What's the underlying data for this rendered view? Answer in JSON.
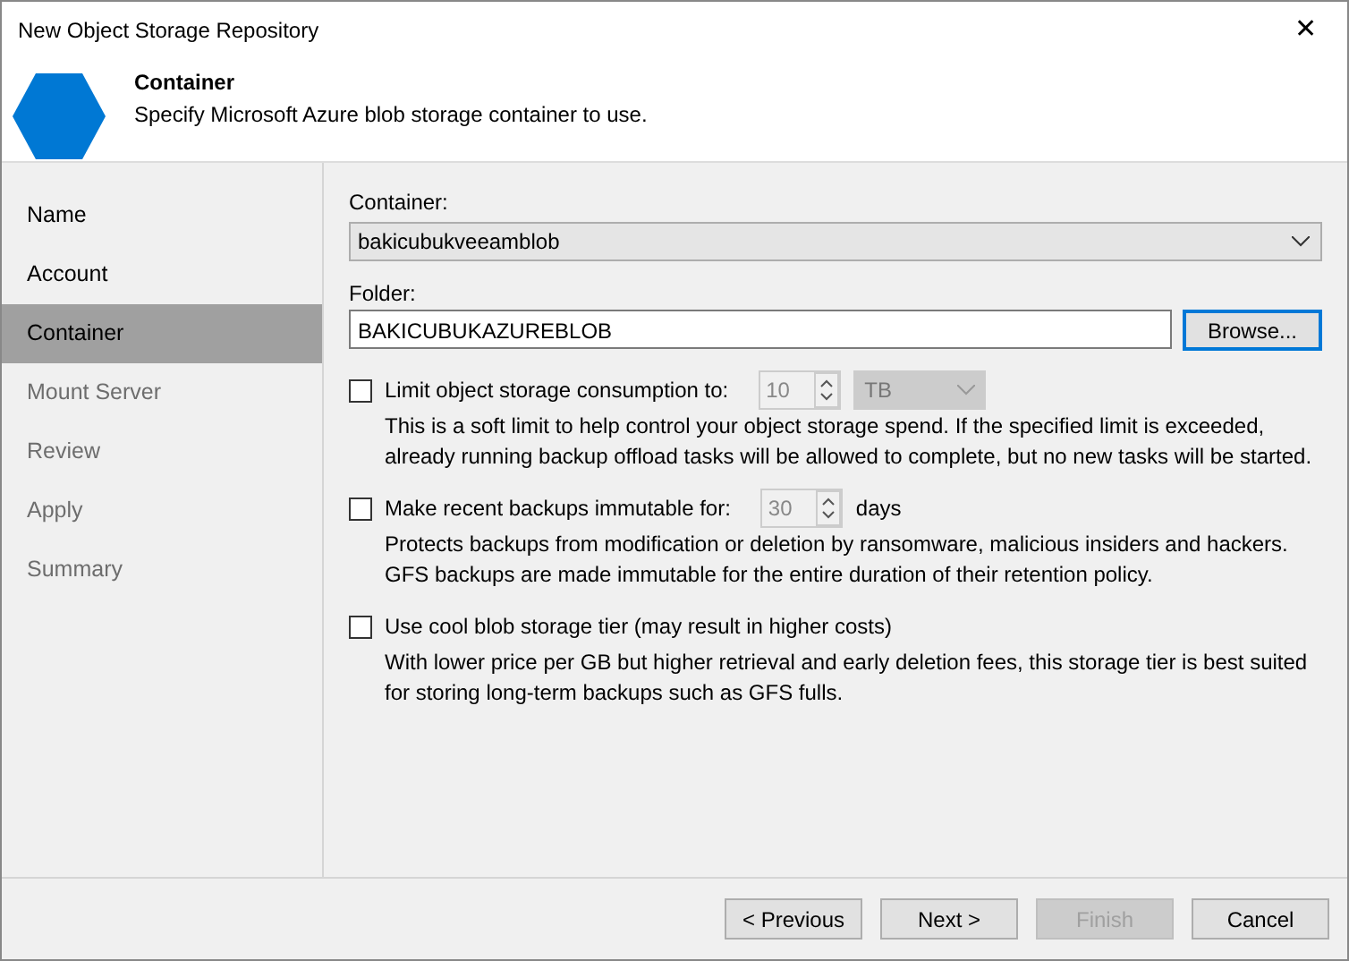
{
  "window": {
    "title": "New Object Storage Repository",
    "close": "✕"
  },
  "header": {
    "title": "Container",
    "subtitle": "Specify Microsoft Azure blob storage container to use."
  },
  "steps": [
    {
      "label": "Name",
      "selected": false,
      "enabled": true
    },
    {
      "label": "Account",
      "selected": false,
      "enabled": true
    },
    {
      "label": "Container",
      "selected": true,
      "enabled": true
    },
    {
      "label": "Mount Server",
      "selected": false,
      "enabled": false
    },
    {
      "label": "Review",
      "selected": false,
      "enabled": false
    },
    {
      "label": "Apply",
      "selected": false,
      "enabled": false
    },
    {
      "label": "Summary",
      "selected": false,
      "enabled": false
    }
  ],
  "container": {
    "label": "Container:",
    "value": "bakicubukveeamblob"
  },
  "folder": {
    "label": "Folder:",
    "value": "BAKICUBUKAZUREBLOB",
    "button": {
      "label": "Browse...",
      "focused": true
    }
  },
  "options": [
    {
      "kind": "spinner_unit",
      "label": "Limit object storage consumption to:",
      "checked": false,
      "spinner": "10",
      "unit": "TB",
      "description": "This is a soft limit to help control your object storage spend. If the specified limit is exceeded, already running backup offload tasks will be allowed to complete, but no new tasks will be started."
    },
    {
      "kind": "spinner_suffix",
      "label": "Make recent backups immutable for:",
      "checked": false,
      "spinner": "30",
      "suffix": "days",
      "description": "Protects backups from modification or deletion by ransomware, malicious insiders and hackers. GFS backups are made immutable for the entire duration of their retention policy."
    },
    {
      "kind": "plain",
      "label": "Use cool blob storage tier (may result in higher costs)",
      "checked": false,
      "description": "With lower price per GB but higher retrieval and early deletion fees, this storage tier is best suited for storing long-term backups such as GFS fulls."
    }
  ],
  "buttons": [
    {
      "label": "< Previous",
      "disabled": false
    },
    {
      "label": "Next >",
      "disabled": false
    },
    {
      "label": "Finish",
      "disabled": true
    },
    {
      "label": "Cancel",
      "disabled": false
    }
  ]
}
